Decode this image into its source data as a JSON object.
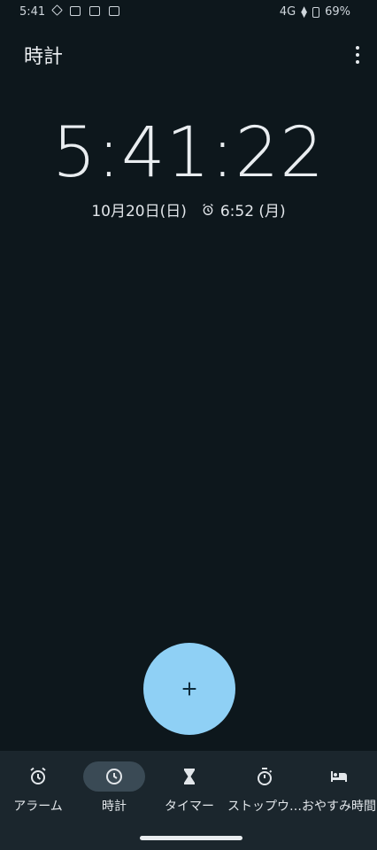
{
  "status_bar": {
    "time": "5:41",
    "network": "4G",
    "battery": "69%"
  },
  "app_bar": {
    "title": "時計",
    "menu_icon": "more-vert-icon"
  },
  "clock": {
    "time": "5:41:22",
    "date": "10月20日(日)",
    "next_alarm": "6:52 (月)",
    "alarm_icon": "alarm-icon"
  },
  "fab": {
    "icon": "add-icon"
  },
  "nav": {
    "items": [
      {
        "label": "アラーム",
        "icon": "alarm-icon",
        "active": false
      },
      {
        "label": "時計",
        "icon": "clock-icon",
        "active": true
      },
      {
        "label": "タイマー",
        "icon": "hourglass-icon",
        "active": false
      },
      {
        "label": "ストップウ…",
        "icon": "stopwatch-icon",
        "active": false
      },
      {
        "label": "おやすみ時間",
        "icon": "bed-icon",
        "active": false
      }
    ]
  },
  "colors": {
    "background": "#0d171c",
    "nav_background": "#1b262d",
    "fab": "#8fd0f5",
    "active_pill": "#3a4a55"
  }
}
